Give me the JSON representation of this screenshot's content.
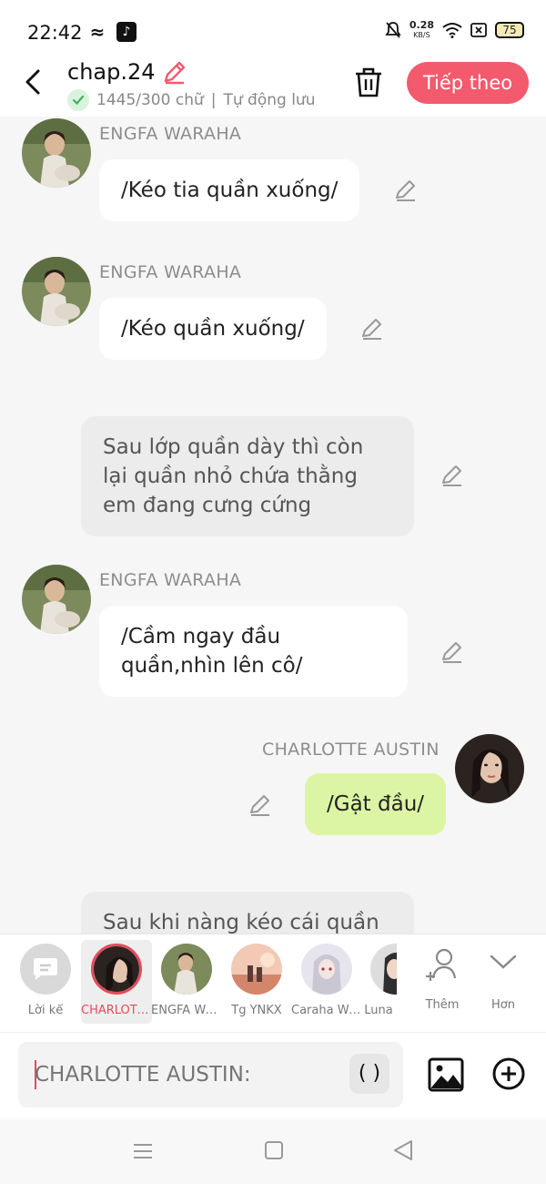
{
  "status_bar": {
    "time": "22:42",
    "net_speed": "0.28",
    "net_unit": "KB/S",
    "battery": "75"
  },
  "header": {
    "title": "chap.24",
    "word_count": "1445/300 chữ",
    "separator": "|",
    "autosave": "Tự động lưu",
    "next_label": "Tiếp theo"
  },
  "messages": [
    {
      "speaker": "ENGFA WARAHA",
      "text": "/Kéo tia quần xuống/"
    },
    {
      "speaker": "ENGFA WARAHA",
      "text": "/Kéo quần xuống/"
    },
    {
      "text": "Sau lớp quần dày thì còn lại quần nhỏ chứa thằng em đang cưng cứng"
    },
    {
      "speaker": "ENGFA WARAHA",
      "text": "/Cầm ngay đầu quần,nhìn lên cô/"
    },
    {
      "speaker": "CHARLOTTE AUSTIN",
      "text": "/Gật đầu/"
    },
    {
      "text": "Sau khi nàng kéo cái quần"
    }
  ],
  "characters": [
    {
      "label": "Lời kể"
    },
    {
      "label": "CHARLOTTE AUSTIN",
      "selected": true
    },
    {
      "label": "ENGFA WARAHA"
    },
    {
      "label": "Tg YNKX"
    },
    {
      "label": "Caraha Wi..."
    },
    {
      "label": "Luna"
    },
    {
      "label": "Thêm"
    },
    {
      "label": "Hơn"
    }
  ],
  "input": {
    "placeholder": "CHARLOTTE AUSTIN:",
    "paren": "( )"
  },
  "colors": {
    "accent": "#f35a6e",
    "my_bubble": "#dcf5a4",
    "narration_bubble": "#ececec"
  }
}
